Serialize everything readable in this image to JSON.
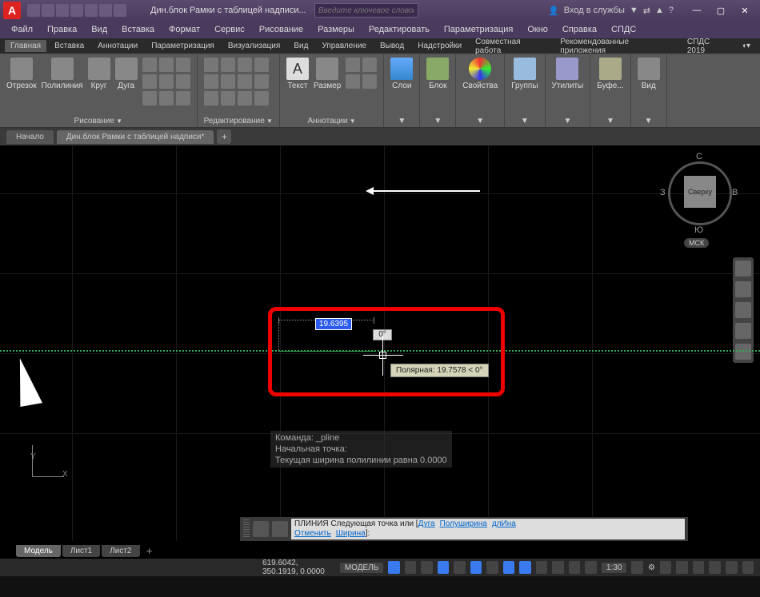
{
  "title": "Дин.блок Рамки с таблицей надписи...",
  "search_placeholder": "Введите ключевое слово/фразу",
  "login": {
    "label": "Вход в службы",
    "dropdown": "▼"
  },
  "menus": [
    "Файл",
    "Правка",
    "Вид",
    "Вставка",
    "Формат",
    "Сервис",
    "Рисование",
    "Размеры",
    "Редактировать",
    "Параметризация",
    "Окно",
    "Справка",
    "СПДС"
  ],
  "ribbon_tabs": [
    "Главная",
    "Вставка",
    "Аннотации",
    "Параметризация",
    "Визуализация",
    "Вид",
    "Управление",
    "Вывод",
    "Надстройки",
    "Совместная работа",
    "Рекомендованные приложения",
    "СПДС 2019"
  ],
  "ribbon_help": "◖▾",
  "panels": {
    "draw": {
      "title": "Рисование",
      "items": [
        "Отрезок",
        "Полилиния",
        "Круг",
        "Дуга"
      ]
    },
    "edit": {
      "title": "Редактирование"
    },
    "ann": {
      "title": "Аннотации",
      "items": [
        "Текст",
        "Размер"
      ]
    },
    "layers": {
      "title": "Слои"
    },
    "block": {
      "title": "Блок"
    },
    "props": {
      "title": "Свойства"
    },
    "groups": {
      "title": "Группы"
    },
    "util": {
      "title": "Утилиты"
    },
    "clip": {
      "title": "Буфе..."
    },
    "view": {
      "title": "Вид"
    }
  },
  "doc_tabs": {
    "start": "Начало",
    "current": "Дин.блок Рамки с таблицей надписи*"
  },
  "viewcube": {
    "face": "Сверху",
    "n": "С",
    "s": "Ю",
    "e": "В",
    "w": "З",
    "ucs": "МСК"
  },
  "dynamic": {
    "dist": "19.6395",
    "angle": "0°",
    "tooltip": "Полярная: 19.7578 < 0°"
  },
  "cmd_history": [
    "Команда: _pline",
    "Начальная точка:",
    "Текущая ширина полилинии равна 0.0000"
  ],
  "cmd": {
    "prefix": "ПЛИНИЯ Следующая точка или [",
    "kwds": [
      "Дуга",
      "Полуширина",
      "длИна",
      "Отменить",
      "Ширина"
    ],
    "suffix": "]:"
  },
  "layout_tabs": [
    "Модель",
    "Лист1",
    "Лист2"
  ],
  "status": {
    "coords": "619.6042, 350.1919, 0.0000",
    "space": "МОДЕЛЬ",
    "scale": "1:30",
    "gear": "⚙"
  }
}
